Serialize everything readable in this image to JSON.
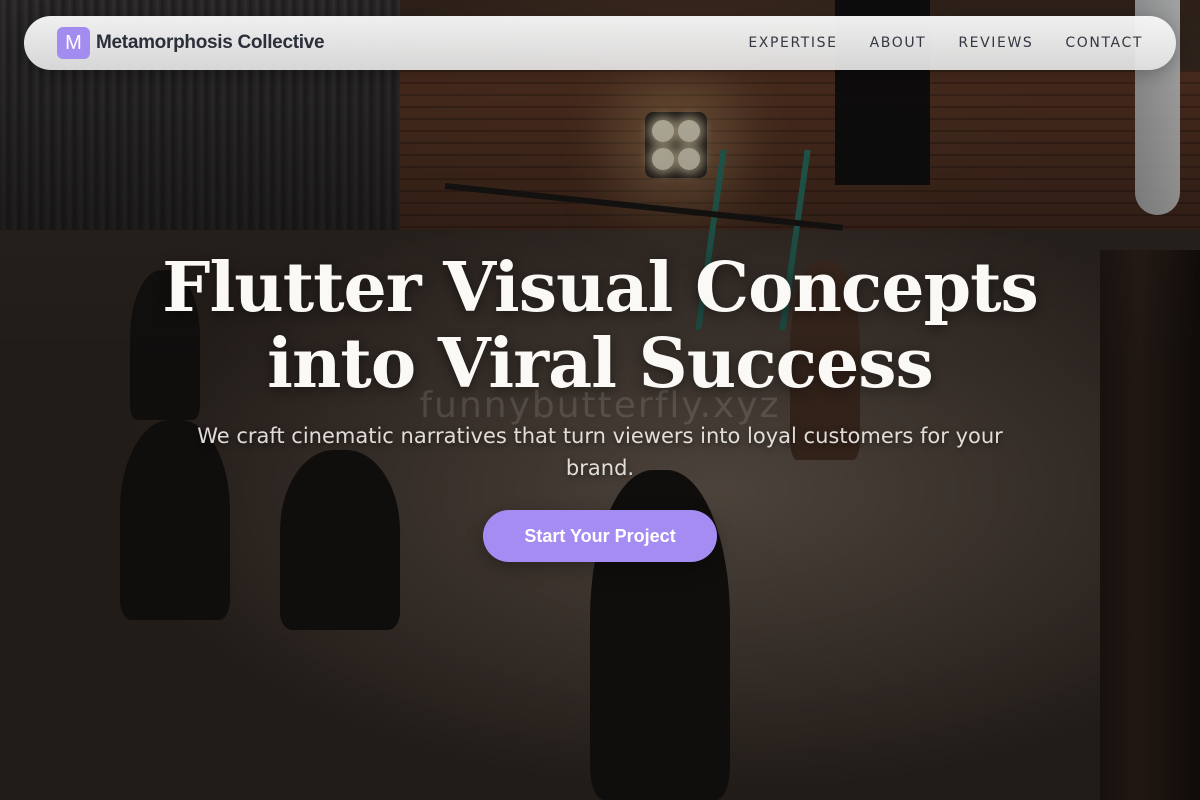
{
  "brand": {
    "logo_letter": "M",
    "name": "Metamorphosis Collective",
    "accent_color": "#a58cf2"
  },
  "nav": {
    "items": [
      {
        "label": "EXPERTISE"
      },
      {
        "label": "ABOUT"
      },
      {
        "label": "REVIEWS"
      },
      {
        "label": "CONTACT"
      }
    ]
  },
  "hero": {
    "headline_line1": "Flutter Visual Concepts",
    "headline_line2": "into Viral Success",
    "subtitle": "We craft cinematic narratives that turn viewers into loyal customers for your brand.",
    "cta_label": "Start Your Project",
    "watermark": "funnybutterfly.xyz"
  }
}
